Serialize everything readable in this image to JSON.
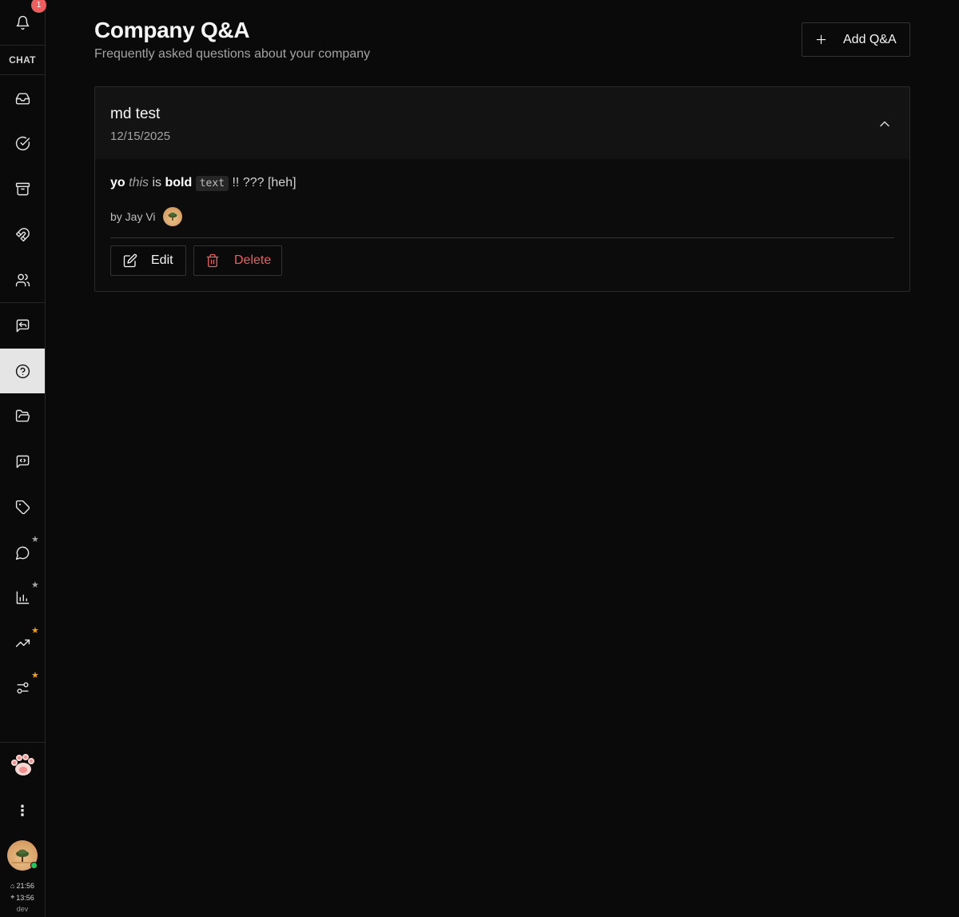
{
  "sidebar": {
    "notification_count": "1",
    "section_label": "CHAT",
    "items": [
      {
        "icon": "inbox-icon",
        "label": "Inbox"
      },
      {
        "icon": "check-circle-icon",
        "label": "Tasks"
      },
      {
        "icon": "archive-icon",
        "label": "Archive"
      },
      {
        "icon": "magnet-icon",
        "label": "Leads"
      },
      {
        "icon": "users-icon",
        "label": "Contacts"
      },
      {
        "icon": "message-reply-icon",
        "label": "Canned responses"
      },
      {
        "icon": "help-circle-icon",
        "label": "Company Q&A"
      },
      {
        "icon": "folder-open-icon",
        "label": "Files"
      },
      {
        "icon": "code-message-icon",
        "label": "Widget"
      },
      {
        "icon": "tag-icon",
        "label": "Tags"
      },
      {
        "icon": "chat-bubble-icon",
        "label": "Chats"
      },
      {
        "icon": "bar-chart-icon",
        "label": "Reports"
      },
      {
        "icon": "trending-up-icon",
        "label": "Analytics"
      },
      {
        "icon": "sliders-icon",
        "label": "Settings"
      }
    ],
    "active_item": "Company Q&A",
    "time_primary": "21:56",
    "time_local": "13:56",
    "env": "dev",
    "star_colors": {
      "gray": "#a3a3a3",
      "orange": "#f59e0b"
    }
  },
  "header": {
    "title": "Company Q&A",
    "subtitle": "Frequently asked questions about your company",
    "add_button": "Add Q&A"
  },
  "qa_items": [
    {
      "question": "md test",
      "date": "12/15/2025",
      "answer": {
        "part1": "yo",
        "part2": "this",
        "part3": "is",
        "part4": "bold",
        "code": "text",
        "part5": "!! ??? [heh]"
      },
      "author": "by Jay Vi",
      "edit_label": "Edit",
      "delete_label": "Delete"
    }
  ],
  "colors": {
    "background": "#0a0a0a",
    "accent_danger": "#f25c5c",
    "online": "#22c55e",
    "badge": "#f05d5d"
  }
}
